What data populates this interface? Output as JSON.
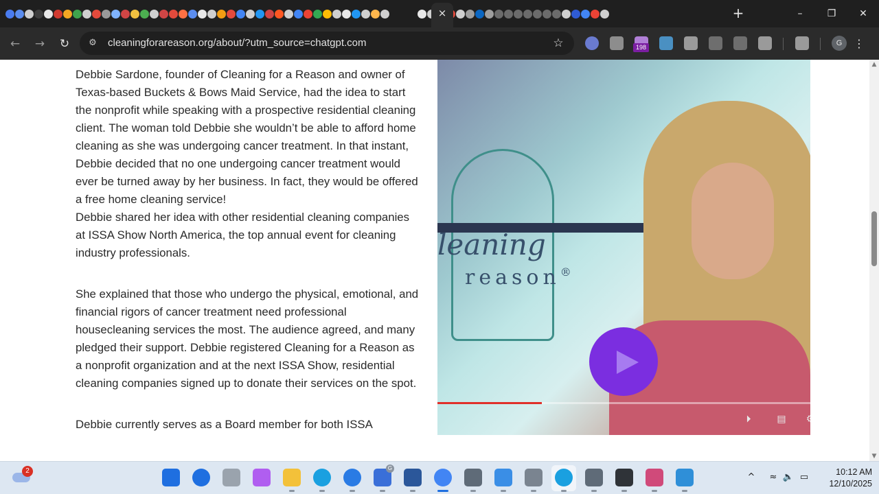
{
  "browser": {
    "tab_close_label": "×",
    "new_tab_label": "+",
    "window_controls": {
      "minimize": "–",
      "restore": "❐",
      "close": "✕"
    },
    "favicon_colors": [
      "#4a7cf0",
      "#5b8def",
      "#cfcfcf",
      "#3d3d3d",
      "#e8e8e8",
      "#d03a30",
      "#f5a623",
      "#3fa34d",
      "#cfcfcf",
      "#e34a3c",
      "#9a9a9a",
      "#7fb3ff",
      "#d04545",
      "#f0c040",
      "#4caf50",
      "#cfcfcf",
      "#d04545",
      "#e34a3c",
      "#ff7043",
      "#5b8def",
      "#e8e8e8",
      "#cfcfcf",
      "#f39c12",
      "#e34a3c",
      "#4285f4",
      "#cfcfcf",
      "#2196f3",
      "#d04545",
      "#ff5722",
      "#cfcfcf",
      "#4285f4",
      "#ea4335",
      "#34a853",
      "#fbbc05",
      "#cfcfcf",
      "#e8e8e8",
      "#2196f3",
      "#cfcfcf",
      "#ffb74d",
      "#cfcfcf",
      "#e8e8e8",
      "#cfcfcf",
      "#ff5722",
      "#e34a3c",
      "#cfcfcf",
      "#9e9e9e",
      "#0a66c2",
      "#9e9e9e",
      "#6b6b6b",
      "#6b6b6b",
      "#6b6b6b",
      "#6b6b6b",
      "#6b6b6b",
      "#6b6b6b",
      "#6b6b6b",
      "#cfcfcf",
      "#2f5bd3",
      "#4285f4",
      "#ea4335",
      "#cfcfcf"
    ]
  },
  "toolbar": {
    "back_icon": "←",
    "forward_icon": "→",
    "reload_icon": "↻",
    "site_info_icon": "⚙",
    "url": "cleaningforareason.org/about/?utm_source=chatgpt.com",
    "bookmark_icon": "☆",
    "extension_badge": "198",
    "profile_initial": "G",
    "menu_icon": "⋮",
    "extension_colors": [
      "#6a7bd0",
      "#8d8d8d",
      "#b07fd6",
      "#4a90c2",
      "#9a9a9a",
      "#6e6e6e",
      "#6e6e6e",
      "#9a9a9a",
      "#9a9a9a"
    ]
  },
  "article": {
    "p1": "Debbie Sardone, founder of Cleaning for a Reason and owner of Texas-based Buckets & Bows Maid Service, had the idea to start the nonprofit while speaking with a prospective residential cleaning client. The woman told Debbie she wouldn’t be able to afford home cleaning as she was undergoing cancer treatment. In that instant, Debbie decided that no one undergoing cancer treatment would ever be turned away by her business. In fact, they would be offered a free home cleaning service!",
    "p2": "Debbie shared her idea with other residential cleaning companies at ISSA Show North America, the top annual event for cleaning industry professionals.",
    "p3": "She explained that those who undergo the physical, emotional, and financial rigors of cancer treatment need professional housecleaning services the most. The audience agreed, and many pledged their support. Debbie registered Cleaning for a Reason as a nonprofit organization and at the next ISSA Show, residential cleaning companies signed up to donate their services on the spot.",
    "p4_partial": "Debbie currently serves as a Board member for both ISSA"
  },
  "video": {
    "logo_word_1": "leaning",
    "logo_word_2": "reason",
    "logo_mark": "®",
    "progress": 0.28,
    "progress_color": "#e0302a",
    "play_color": "#7b2ee0",
    "autoplay_icon": "⏵",
    "captions_icon": "▤",
    "settings_icon": "⚙"
  },
  "scrollbar": {
    "up_icon": "▲",
    "down_icon": "▼"
  },
  "taskbar": {
    "weather_badge": "2",
    "apps": [
      {
        "name": "start-button",
        "color": "#1f6fe0"
      },
      {
        "name": "search-app",
        "color": "#1f6fe0"
      },
      {
        "name": "task-view",
        "color": "#9aa3ad"
      },
      {
        "name": "copilot-app",
        "color": "#b05ef0"
      },
      {
        "name": "file-explorer",
        "color": "#f3c13a"
      },
      {
        "name": "edge-profile",
        "color": "#1aa0e0"
      },
      {
        "name": "quick-assist",
        "color": "#2a7be4"
      },
      {
        "name": "google-docs-app",
        "color": "#3a6fd8"
      },
      {
        "name": "word-app",
        "color": "#2b579a"
      },
      {
        "name": "chrome-app",
        "color": "#4285f4"
      },
      {
        "name": "settings-app",
        "color": "#5f6b78"
      },
      {
        "name": "photos-app",
        "color": "#3a8ee6"
      },
      {
        "name": "usb-device-app",
        "color": "#7a8490"
      },
      {
        "name": "edge-app",
        "color": "#1aa0e0"
      },
      {
        "name": "camera-app",
        "color": "#5f6b78"
      },
      {
        "name": "gear-app",
        "color": "#2f3338"
      },
      {
        "name": "snipping-tool",
        "color": "#d04a7a"
      },
      {
        "name": "notepad-app",
        "color": "#2f8fd8"
      }
    ],
    "docs_badge": "G",
    "tray_chevron": "^",
    "tray_wifi": "≈",
    "tray_volume": "🔈",
    "tray_battery": "▭",
    "time": "10:12 AM",
    "date": "12/10/2025"
  }
}
